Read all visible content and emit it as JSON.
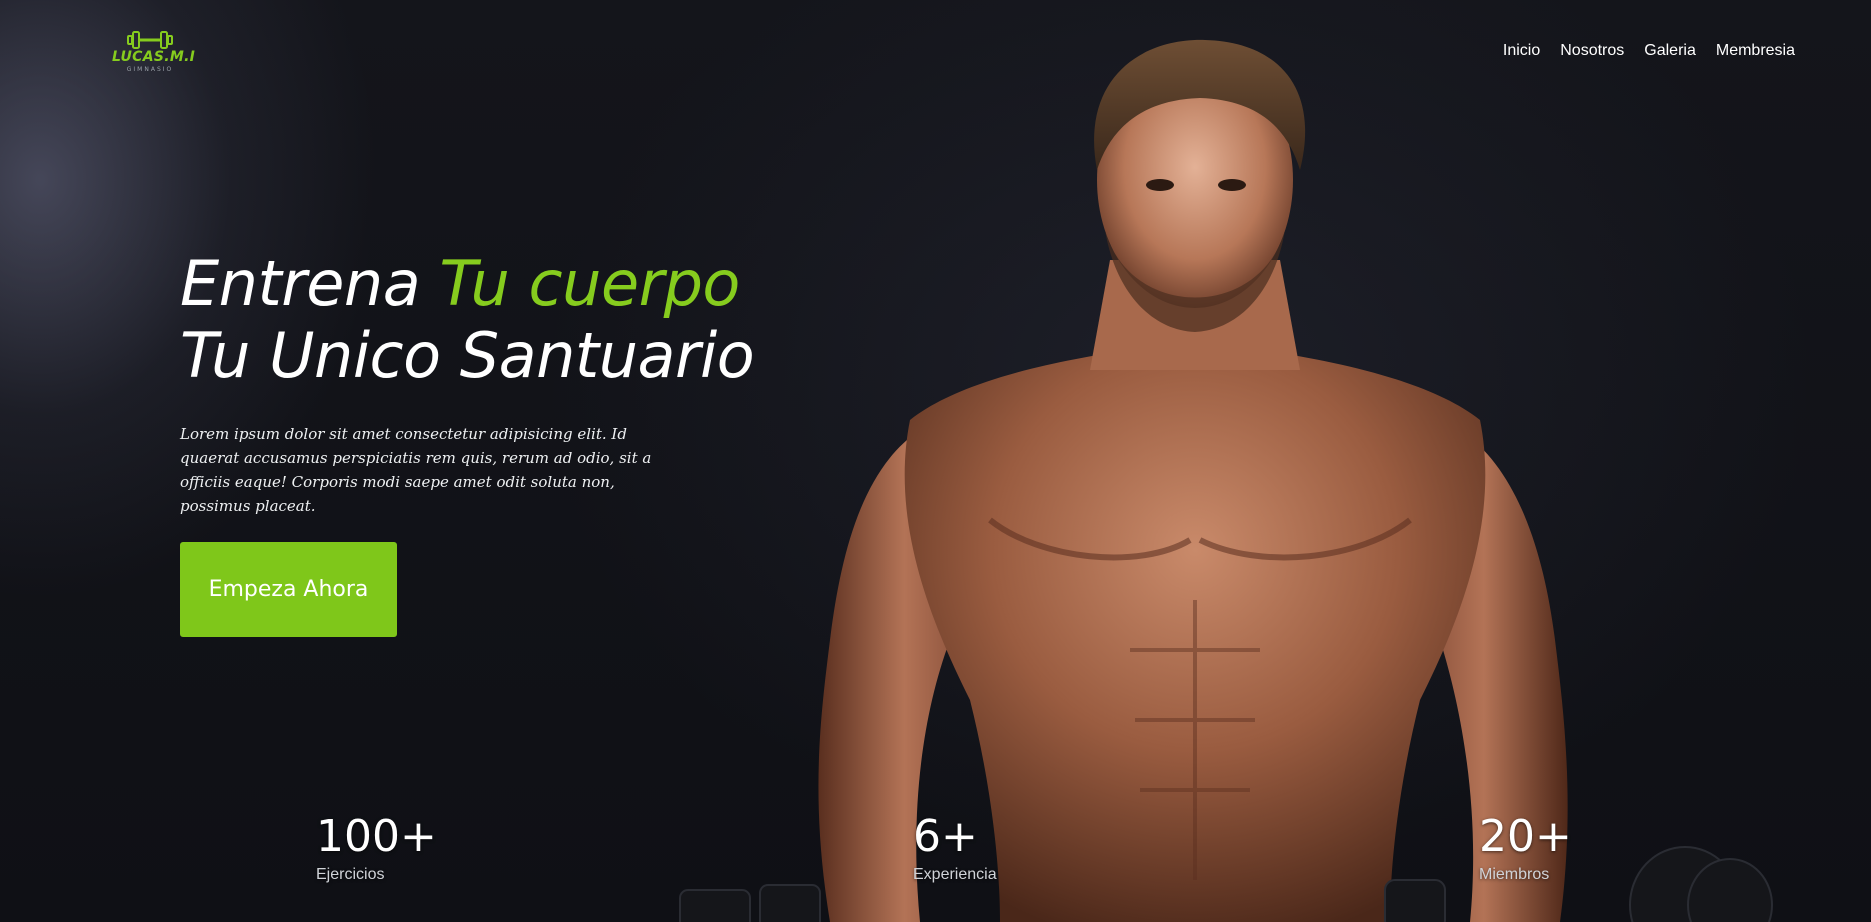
{
  "brand": {
    "name": "LUCAS.M.I",
    "tagline": "GIMNASIO",
    "logo_icon": "dumbbell-icon",
    "accent_color": "#86cc1e"
  },
  "nav": {
    "items": [
      {
        "label": "Inicio"
      },
      {
        "label": "Nosotros"
      },
      {
        "label": "Galeria"
      },
      {
        "label": "Membresia"
      }
    ]
  },
  "hero": {
    "headline_part1": "Entrena ",
    "headline_accent": "Tu cuerpo",
    "headline_line2": "Tu Unico Santuario",
    "lead": "Lorem ipsum dolor sit amet consectetur adipisicing elit. Id quaerat accusamus perspiciatis rem quis, rerum ad odio, sit a officiis eaque! Corporis modi saepe amet odit soluta non, possimus placeat.",
    "cta_label": "Empeza Ahora",
    "cta_color": "#7fc71a",
    "image": "muscular-man-with-dumbbells"
  },
  "stats": [
    {
      "value": "100+",
      "label": "Ejercicios"
    },
    {
      "value": "6+",
      "label": "Experiencia"
    },
    {
      "value": "20+",
      "label": "Miembros"
    }
  ]
}
